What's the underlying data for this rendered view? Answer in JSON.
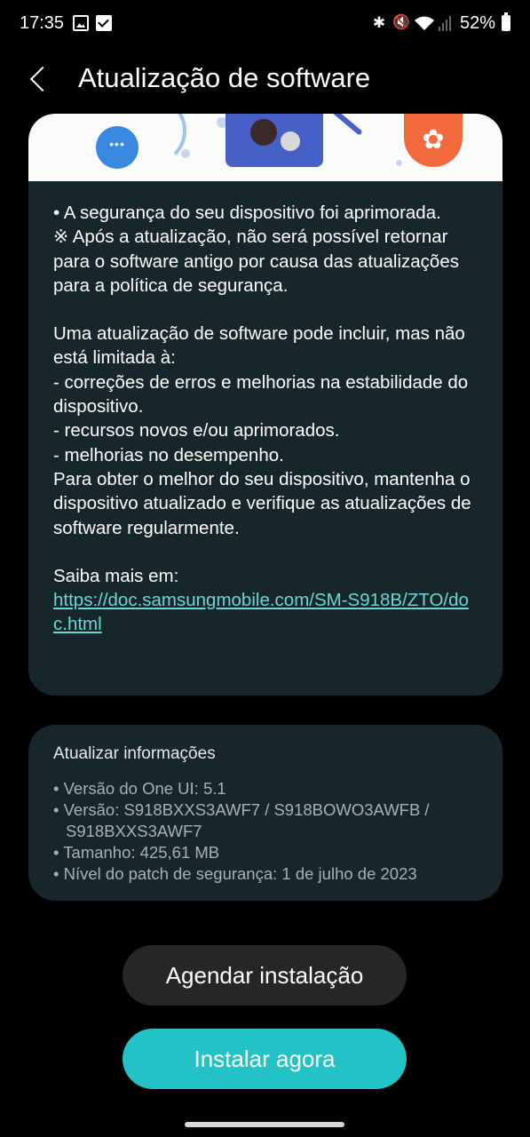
{
  "status_bar": {
    "time": "17:35",
    "battery": "52%"
  },
  "header": {
    "title": "Atualização de software"
  },
  "main_card": {
    "line1": "• A segurança do seu dispositivo foi aprimorada.",
    "line2": "※ Após a atualização, não será possível retornar para o software antigo por causa das atualizações para a política de segurança.",
    "intro": "Uma atualização de software pode incluir, mas não está limitada à:",
    "bullet1": " - correções de erros e melhorias na estabilidade do dispositivo.",
    "bullet2": " - recursos novos e/ou aprimorados.",
    "bullet3": " - melhorias no desempenho.",
    "closing": "Para obter o melhor do seu dispositivo, mantenha o dispositivo atualizado e verifique as atualizações de software regularmente.",
    "more_label": "Saiba mais em:",
    "link": "https://doc.samsungmobile.com/SM-S918B/ZTO/doc.html"
  },
  "info_card": {
    "title": "Atualizar informações",
    "oneui": "• Versão do One UI: 5.1",
    "version": "• Versão: S918BXXS3AWF7 / S918BOWO3AWFB /",
    "version_cont": "S918BXXS3AWF7",
    "size": "• Tamanho: 425,61 MB",
    "patch": "• Nível do patch de segurança: 1 de julho de 2023"
  },
  "buttons": {
    "schedule": "Agendar instalação",
    "install": "Instalar agora"
  },
  "colors": {
    "accent": "#23c2c6",
    "link": "#6ad8d2",
    "card": "#17262a"
  }
}
